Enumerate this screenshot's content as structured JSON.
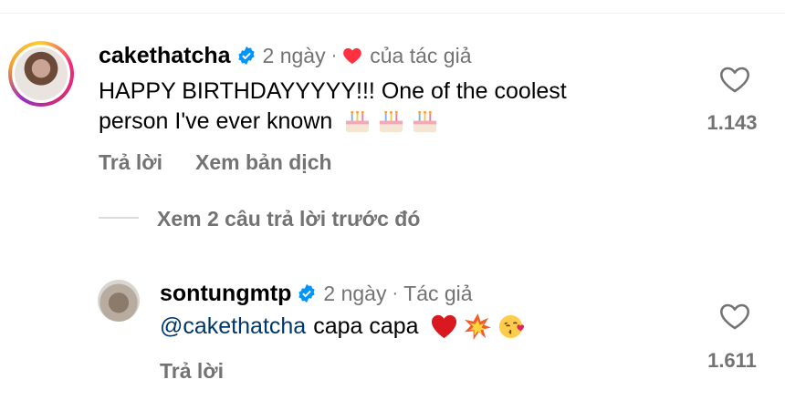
{
  "comments": [
    {
      "username": "cakethatcha",
      "time": "2 ngày",
      "author_like_label": "của tác giả",
      "text": "HAPPY BIRTHDAYYYYY!!! One of the coolest",
      "text_line2": "person I've ever known",
      "emojis": [
        "birthday-cake-emoji",
        "birthday-cake-emoji",
        "birthday-cake-emoji"
      ],
      "likes": "1.143",
      "reply_label": "Trả lời",
      "translate_label": "Xem bản dịch"
    }
  ],
  "view_replies_label": "Xem 2 câu trả lời trước đó",
  "reply": {
    "username": "sontungmtp",
    "time": "2 ngày",
    "author_label": "Tác giả",
    "mention": "@cakethatcha",
    "text": "capa capa",
    "emojis": [
      "red-heart-emoji",
      "collision-emoji",
      "kissing-face-emoji"
    ],
    "likes": "1.611",
    "reply_label": "Trả lời"
  },
  "colors": {
    "verified": "#0095f6",
    "heart": "#ff3040",
    "muted": "#737373",
    "mention": "#00376b"
  }
}
